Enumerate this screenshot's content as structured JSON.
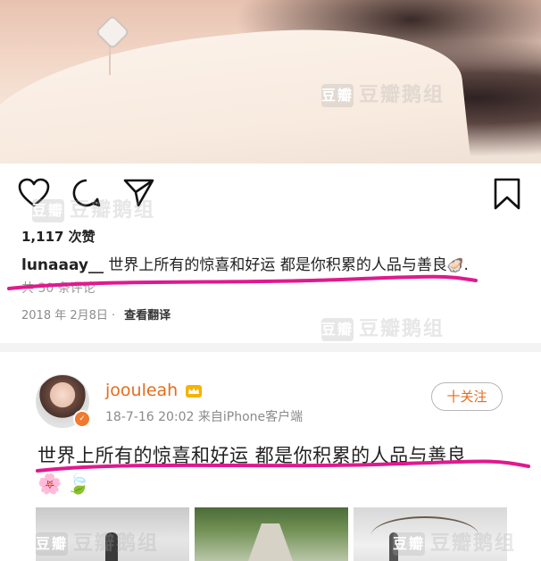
{
  "instagram": {
    "likes": "1,117 次赞",
    "caption_user": "lunaaay__",
    "caption_text": "世界上所有的惊喜和好运 都是你积累的人品与善良",
    "caption_end_emoji": "🦪",
    "caption_end": ".",
    "comments_partial": "共 30 条评论",
    "date": "2018 年 2月8日 ·",
    "translate": "查看翻译"
  },
  "weibo": {
    "username": "joouleah",
    "crown_icon": "crown-icon",
    "meta": "18-7-16 20:02  来自iPhone客户端",
    "follow": "十关注",
    "text": "世界上所有的惊喜和好运 都是你积累的人品与善良",
    "emojis": [
      "🌸",
      "🍃"
    ]
  },
  "watermark": {
    "logo": "豆瓣",
    "text": "豆瓣鹅组"
  },
  "colors": {
    "weibo_orange": "#e46c1d",
    "highlight": "#e0198f"
  }
}
